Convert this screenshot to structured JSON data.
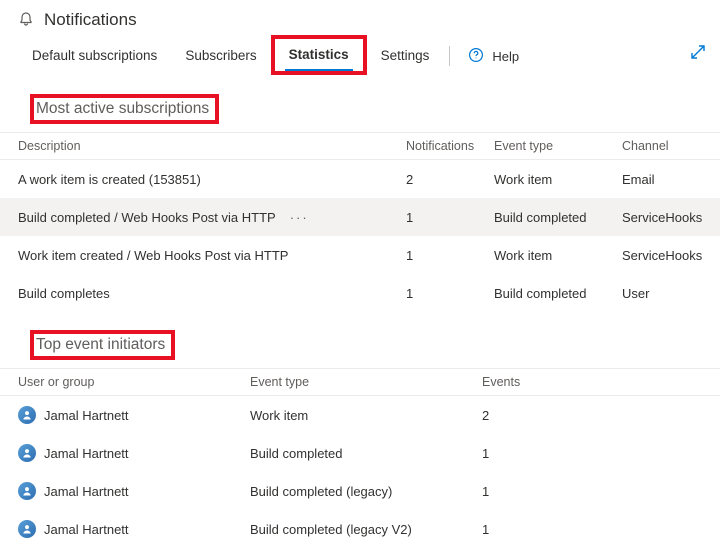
{
  "header": {
    "title": "Notifications"
  },
  "tabs": {
    "default_subscriptions": "Default subscriptions",
    "subscribers": "Subscribers",
    "statistics": "Statistics",
    "settings": "Settings",
    "help": "Help"
  },
  "sections": {
    "active_subs": "Most active subscriptions",
    "top_initiators": "Top event initiators"
  },
  "subs_columns": {
    "description": "Description",
    "notifications": "Notifications",
    "event_type": "Event type",
    "channel": "Channel"
  },
  "subs_rows": [
    {
      "description": "A work item is created (153851)",
      "notifications": "2",
      "event_type": "Work item",
      "channel": "Email"
    },
    {
      "description": "Build completed / Web Hooks Post via HTTP",
      "notifications": "1",
      "event_type": "Build completed",
      "channel": "ServiceHooks"
    },
    {
      "description": "Work item created / Web Hooks Post via HTTP",
      "notifications": "1",
      "event_type": "Work item",
      "channel": "ServiceHooks"
    },
    {
      "description": "Build completes",
      "notifications": "1",
      "event_type": "Build completed",
      "channel": "User"
    }
  ],
  "init_columns": {
    "user": "User or group",
    "event_type": "Event type",
    "events": "Events"
  },
  "init_rows": [
    {
      "user": "Jamal Hartnett",
      "event_type": "Work item",
      "events": "2"
    },
    {
      "user": "Jamal Hartnett",
      "event_type": "Build completed",
      "events": "1"
    },
    {
      "user": "Jamal Hartnett",
      "event_type": "Build completed (legacy)",
      "events": "1"
    },
    {
      "user": "Jamal Hartnett",
      "event_type": "Build completed (legacy V2)",
      "events": "1"
    }
  ],
  "icons": {
    "more": "···"
  }
}
